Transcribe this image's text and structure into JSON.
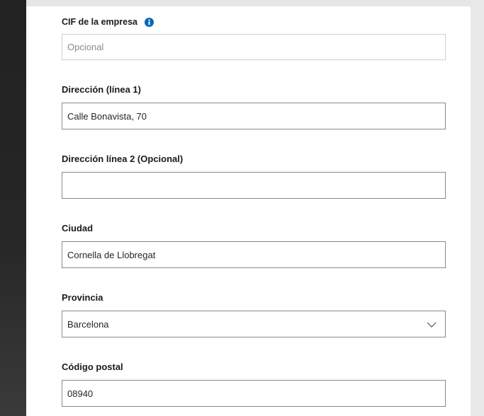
{
  "form": {
    "company_tax_id": {
      "label": "CIF de la empresa",
      "placeholder": "Opcional",
      "value": ""
    },
    "address_line1": {
      "label": "Dirección (línea 1)",
      "value": "Calle Bonavista, 70"
    },
    "address_line2": {
      "label": "Dirección línea 2 (Opcional)",
      "value": ""
    },
    "city": {
      "label": "Ciudad",
      "value": "Cornella de Llobregat"
    },
    "province": {
      "label": "Provincia",
      "selected": "Barcelona"
    },
    "postal_code": {
      "label": "Código postal",
      "value": "08940"
    }
  },
  "icons": {
    "info": "info-icon",
    "dropdown": "chevron-down-icon"
  },
  "colors": {
    "info_icon": "#0067b8",
    "input_border": "#8a8a8a",
    "placeholder_border": "#cfcfcf",
    "sidebar_dark": "#262626"
  }
}
